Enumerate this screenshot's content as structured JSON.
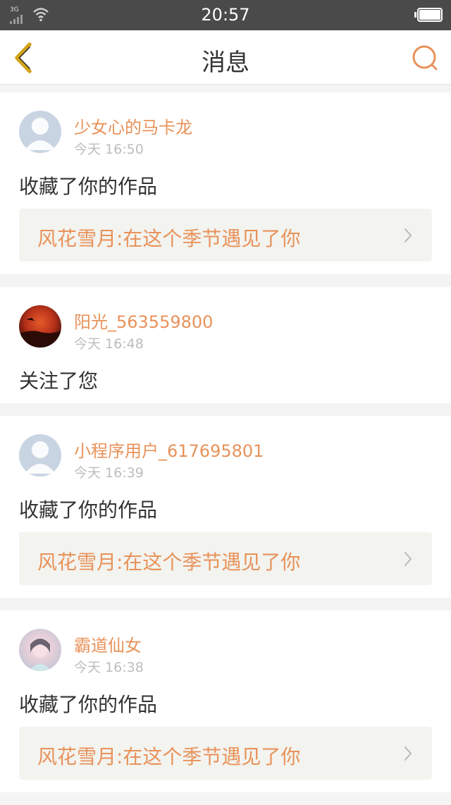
{
  "status_bar": {
    "network": "3G",
    "time": "20:57"
  },
  "nav": {
    "title": "消息",
    "back_icon": "chevron-left-icon",
    "search_icon": "search-icon",
    "accent_color": "#e8925a",
    "back_color": "#d4a21a"
  },
  "messages": [
    {
      "username": "少女心的马卡龙",
      "time": "今天 16:50",
      "action": "收藏了你的作品",
      "work_title": "风花雪月:在这个季节遇见了你"
    },
    {
      "username": "阳光_563559800",
      "time": "今天 16:48",
      "action": "关注了您"
    },
    {
      "username": "小程序用户_617695801",
      "time": "今天 16:39",
      "action": "收藏了你的作品",
      "work_title": "风花雪月:在这个季节遇见了你"
    },
    {
      "username": "霸道仙女",
      "time": "今天 16:38",
      "action": "收藏了你的作品",
      "work_title": "风花雪月:在这个季节遇见了你"
    }
  ]
}
